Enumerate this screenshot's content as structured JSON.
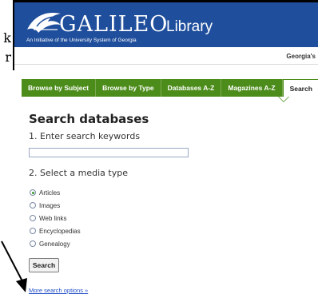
{
  "margin_text": {
    "k": "k",
    "r": "r"
  },
  "header": {
    "logo_name": "GALILEO",
    "logo_suffix": "Library",
    "tagline": "An Initiative of the University System of Georgia",
    "brand_color": "#1f4e9c"
  },
  "subheader": {
    "text": "Georgia's"
  },
  "nav": {
    "color": "#4c8c1a",
    "tabs": [
      {
        "label": "Browse by Subject"
      },
      {
        "label": "Browse by Type"
      },
      {
        "label": "Databases A-Z"
      },
      {
        "label": "Magazines A-Z"
      },
      {
        "label": "Search"
      }
    ],
    "active_index": 4
  },
  "main": {
    "title": "Search databases",
    "step1": "1. Enter search keywords",
    "search_value": "",
    "step2": "2. Select a media type",
    "media_types": [
      {
        "label": "Articles",
        "checked": true
      },
      {
        "label": "Images",
        "checked": false
      },
      {
        "label": "Web links",
        "checked": false
      },
      {
        "label": "Encyclopedias",
        "checked": false
      },
      {
        "label": "Genealogy",
        "checked": false
      }
    ],
    "search_button": "Search",
    "more_link": "More search options »"
  }
}
